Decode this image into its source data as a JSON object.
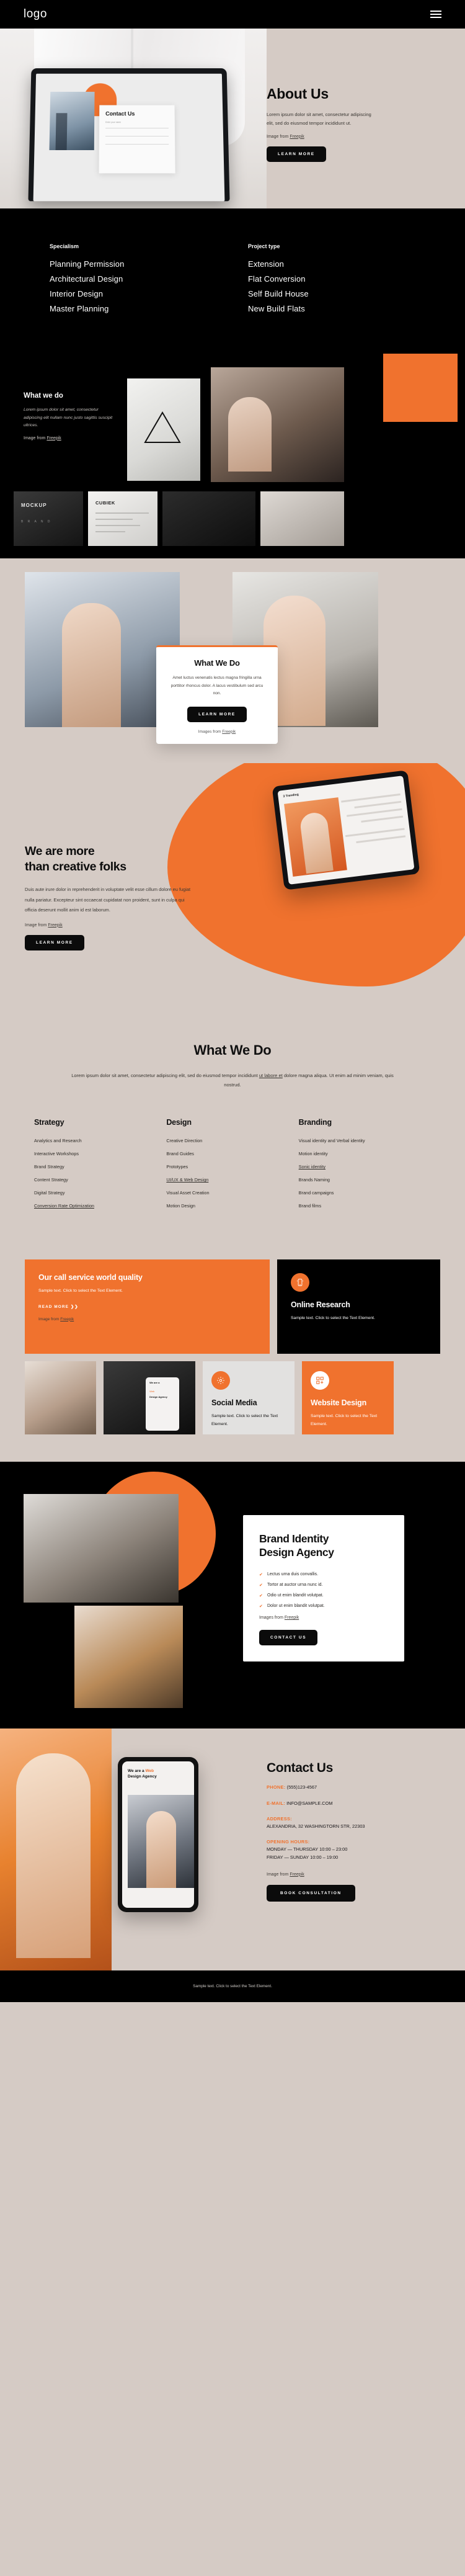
{
  "header": {
    "logo": "logo",
    "menu_icon": "hamburger-menu"
  },
  "about": {
    "title": "About Us",
    "body": "Lorem ipsum dolor sit amet, consectetur adipiscing elit, sed do eiusmod tempor incididunt ut.",
    "credit_prefix": "Image from ",
    "credit_link": "Freepik",
    "button": "LEARN MORE",
    "laptop_screen_title": "Contact Us",
    "laptop_field_label": "Enter your name"
  },
  "dark_lists": {
    "columns": [
      {
        "heading": "Specialism",
        "items": [
          "Planning Permission",
          "Architectural Design",
          "Interior Design",
          "Master Planning"
        ]
      },
      {
        "heading": "Project type",
        "items": [
          "Extension",
          "Flat Conversion",
          "Self Build House",
          "New Build Flats"
        ]
      }
    ]
  },
  "collage": {
    "title": "What we do",
    "body": "Lorem ipsum dolor sit amet, consectetur adipiscing elit nullam nunc justo sagittis suscipit ultrices.",
    "credit_prefix": "Image from ",
    "credit_link": "Freepik",
    "mockup_label": "MOCKUP",
    "mockup_sub": "B R A N D",
    "cubiek_label": "CUBIEK"
  },
  "team_card": {
    "title": "What We Do",
    "body": "Amet luctus venenatis lectus magna fringilla urna porttitor rhoncus dolor. A lacus vestibulum sed arcu non.",
    "button": "LEARN MORE",
    "credit_prefix": "Images from ",
    "credit_link": "Freepik"
  },
  "creative": {
    "title_line1": "We are more",
    "title_line2": "than creative folks",
    "body": "Duis aute irure dolor in reprehenderit in voluptate velit esse cillum dolore eu fugiat nulla pariatur. Excepteur sint occaecat cupidatat non proident, sunt in culpa qui officia deserunt mollit anim id est laborum.",
    "credit_prefix": "Image from ",
    "credit_link": "Freepik",
    "button": "LEARN MORE",
    "tablet_headline": "3 Trending"
  },
  "services": {
    "title": "What We Do",
    "intro_a": "Lorem ipsum dolor sit amet, consectetur adipiscing elit, sed do eiusmod tempor incididunt ",
    "intro_link1": "ut labore et",
    "intro_b": " dolore magna aliqua. Ut enim ad minim veniam, quis nostrud.",
    "columns": [
      {
        "heading": "Strategy",
        "items": [
          {
            "label": "Analytics and Research",
            "underline": false
          },
          {
            "label": "Interactive Workshops",
            "underline": false
          },
          {
            "label": "Brand Strategy",
            "underline": false
          },
          {
            "label": "Content Strategy",
            "underline": false
          },
          {
            "label": "Digital Strategy",
            "underline": false
          },
          {
            "label": "Conversion Rate Optimization",
            "underline": true
          }
        ]
      },
      {
        "heading": "Design",
        "items": [
          {
            "label": "Creative Direction",
            "underline": false
          },
          {
            "label": "Brand Guides",
            "underline": false
          },
          {
            "label": "Prototypes",
            "underline": false
          },
          {
            "label": "UI/UX & Web Design",
            "underline": true
          },
          {
            "label": "Visual Asset Creation",
            "underline": false
          },
          {
            "label": "Motion Design",
            "underline": false
          }
        ]
      },
      {
        "heading": "Branding",
        "items": [
          {
            "label": "Visual identity and Verbal identity",
            "underline": false
          },
          {
            "label": "Motion identity",
            "underline": false
          },
          {
            "label": "Sonic identity",
            "underline": true
          },
          {
            "label": "Brands Naming",
            "underline": false
          },
          {
            "label": "Brand campaigns",
            "underline": false
          },
          {
            "label": "Brand films",
            "underline": false
          }
        ]
      }
    ]
  },
  "features": {
    "call_quality": {
      "title": "Our call service world quality",
      "body": "Sample text. Click to select the Text Element.",
      "read_more": "READ MORE ❯❯",
      "credit_prefix": "Image from ",
      "credit_link": "Freepik"
    },
    "online_research": {
      "title": "Online Research",
      "body": "Sample text. Click to select the Text Element.",
      "icon": "mobile-phone-icon"
    },
    "social_media": {
      "title": "Social Media",
      "body": "Sample text. Click to select the Text Element.",
      "icon": "gear-icon"
    },
    "website_design": {
      "title": "Website Design",
      "body": "Sample text. Click to select the Text Element.",
      "icon": "grid-plus-icon"
    }
  },
  "brand": {
    "title_line1": "Brand Identity",
    "title_line2": "Design Agency",
    "bullets": [
      "Lectus urna duis convallis.",
      "Tortor at auctor urna nunc id.",
      "Odio ut enim blandit volutpat.",
      "Dolor ut enim blandit volutpat."
    ],
    "credit_prefix": "Images from ",
    "credit_link": "Freepik",
    "button": "CONTACT US"
  },
  "contact": {
    "title": "Contact Us",
    "phone_key": "PHONE:",
    "phone_value": "(555)123-4567",
    "email_key": "E-MAIL:",
    "email_value": "INFO@SAMPLE.COM",
    "address_key": "ADDRESS:",
    "address_value": "ALEXANDRIA, 32 WASHINGTORN STR, 22303",
    "hours_key": "OPENING HOURS:",
    "hours_line1": "MONDAY — THURSDAY 10:00 – 23:00",
    "hours_line2": "FRIDAY — SUNDAY 10:00 – 19:00",
    "credit_prefix": "Image from ",
    "credit_link": "Freepik",
    "button": "BOOK CONSULTATION",
    "phone_headline_a": "We are a ",
    "phone_headline_b": "Web",
    "phone_headline_c": "Design Agency"
  },
  "footer": {
    "text": "Sample text. Click to select the Text Element."
  },
  "colors": {
    "accent": "#f0722e",
    "dark": "#000000",
    "beige": "#d5cbc5"
  }
}
